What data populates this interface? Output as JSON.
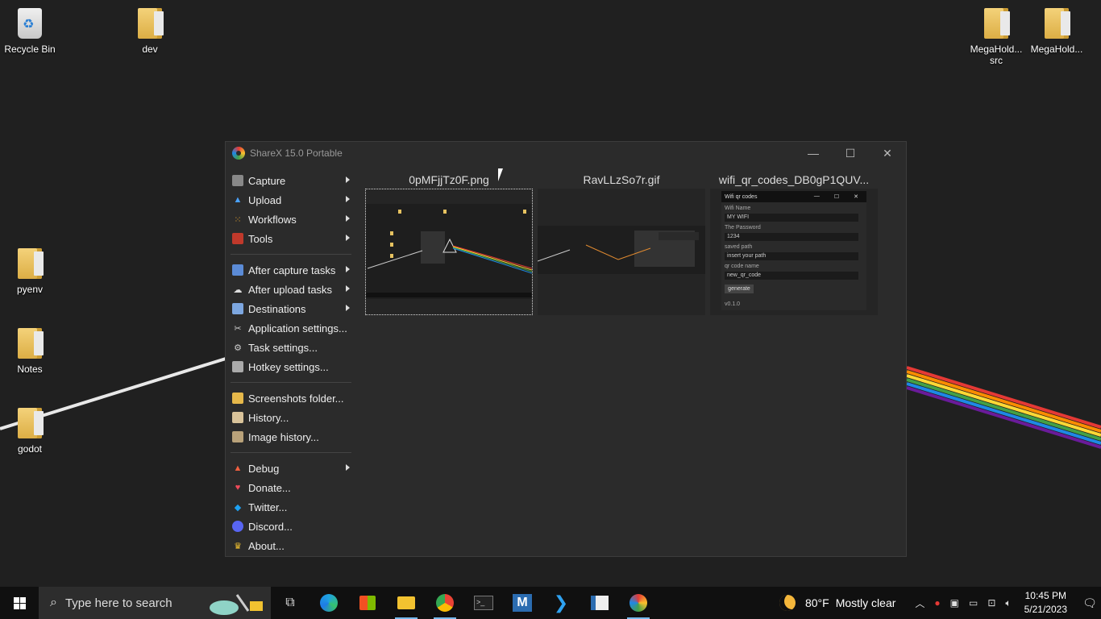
{
  "desktop": {
    "icons": [
      {
        "label": "Recycle Bin",
        "kind": "recycle-bin-icon"
      },
      {
        "label": "dev",
        "kind": "folder-icon"
      },
      {
        "label": "MegaHold... src",
        "kind": "folder-icon"
      },
      {
        "label": "MegaHold...",
        "kind": "folder-icon"
      },
      {
        "label": "pyenv",
        "kind": "folder-icon"
      },
      {
        "label": "Notes",
        "kind": "folder-icon"
      },
      {
        "label": "godot",
        "kind": "folder-icon"
      }
    ]
  },
  "window": {
    "title": "ShareX 15.0 Portable",
    "controls": {
      "minimize": "—",
      "maximize": "☐",
      "close": "✕"
    }
  },
  "menu": {
    "items": [
      {
        "label": "Capture",
        "icon": "camera-icon",
        "submenu": true
      },
      {
        "label": "Upload",
        "icon": "upload-arrow-icon",
        "submenu": true
      },
      {
        "label": "Workflows",
        "icon": "grid-dots-icon",
        "submenu": true
      },
      {
        "label": "Tools",
        "icon": "toolbox-icon",
        "submenu": true
      },
      {
        "label": "After capture tasks",
        "icon": "screen-icon",
        "submenu": true
      },
      {
        "label": "After upload tasks",
        "icon": "cloud-icon",
        "submenu": true
      },
      {
        "label": "Destinations",
        "icon": "drive-icon",
        "submenu": true
      },
      {
        "label": "Application settings...",
        "icon": "wrench-icon",
        "submenu": false
      },
      {
        "label": "Task settings...",
        "icon": "gear-icon",
        "submenu": false
      },
      {
        "label": "Hotkey settings...",
        "icon": "key-icon",
        "submenu": false
      },
      {
        "label": "Screenshots folder...",
        "icon": "folder-icon",
        "submenu": false
      },
      {
        "label": "History...",
        "icon": "history-icon",
        "submenu": false
      },
      {
        "label": "Image history...",
        "icon": "image-grid-icon",
        "submenu": false
      },
      {
        "label": "Debug",
        "icon": "cone-icon",
        "submenu": true
      },
      {
        "label": "Donate...",
        "icon": "heart-icon",
        "submenu": false
      },
      {
        "label": "Twitter...",
        "icon": "twitter-icon",
        "submenu": false
      },
      {
        "label": "Discord...",
        "icon": "discord-icon",
        "submenu": false
      },
      {
        "label": "About...",
        "icon": "crown-icon",
        "submenu": false
      }
    ]
  },
  "thumbnails": [
    {
      "title": "0pMFjjTz0F.png",
      "selected": true
    },
    {
      "title": "RavLLzSo7r.gif",
      "selected": false
    },
    {
      "title": "wifi_qr_codes_DB0gP1QUV...",
      "selected": false
    }
  ],
  "qr_app": {
    "title": "Wifi qr codes",
    "wifi_label": "Wifi Name",
    "wifi_value": "MY WIFI",
    "pass_label": "The Password",
    "pass_value": "1234",
    "path_label": "saved path",
    "path_value": "insert your path",
    "name_label": "qr code name",
    "name_value": "new_qr_code",
    "button": "generate",
    "version": "v0.1.0"
  },
  "taskbar": {
    "search_placeholder": "Type here to search",
    "weather_temp": "80°F",
    "weather_text": "Mostly clear",
    "time": "10:45 PM",
    "date": "5/21/2023"
  },
  "colors": {
    "accent": "#76b9ed",
    "window_bg": "#2b2b2b",
    "desktop_bg": "#202020"
  }
}
